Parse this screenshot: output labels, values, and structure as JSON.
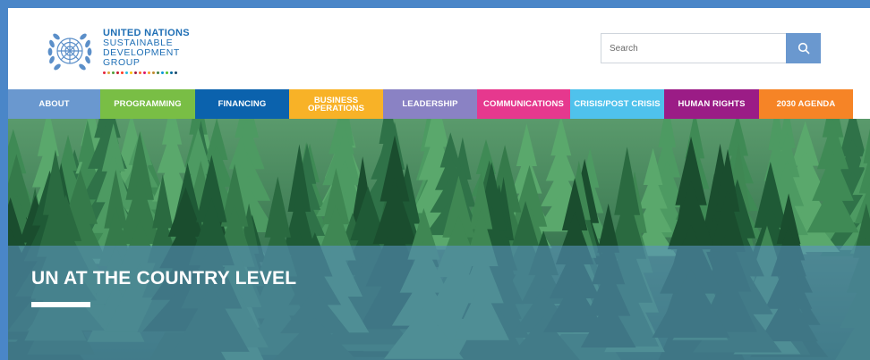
{
  "header": {
    "brand": {
      "line1": "UNITED NATIONS",
      "line2": "SUSTAINABLE",
      "line3": "DEVELOPMENT",
      "line4": "GROUP"
    },
    "logo_icon": "un-emblem-icon",
    "sdg_colors": [
      "#e5243b",
      "#dda63a",
      "#4c9f38",
      "#c5192d",
      "#ff3a21",
      "#26bde2",
      "#fcc30b",
      "#a21942",
      "#fd6925",
      "#dd1367",
      "#fd9d24",
      "#bf8b2e",
      "#3f7e44",
      "#0a97d9",
      "#56c02b",
      "#00689d",
      "#19486a"
    ],
    "search": {
      "placeholder": "Search",
      "value": "",
      "icon": "search-icon"
    }
  },
  "nav": {
    "items": [
      {
        "label": "ABOUT",
        "color": "#6a98cf"
      },
      {
        "label": "PROGRAMMING",
        "color": "#79be45"
      },
      {
        "label": "FINANCING",
        "color": "#0b62ad"
      },
      {
        "label": "BUSINESS OPERATIONS",
        "color": "#f8b227"
      },
      {
        "label": "LEADERSHIP",
        "color": "#8a82c4"
      },
      {
        "label": "COMMUNICATIONS",
        "color": "#e6388e"
      },
      {
        "label": "CRISIS/POST CRISIS",
        "color": "#4fc2ec"
      },
      {
        "label": "HUMAN RIGHTS",
        "color": "#9b1c86"
      },
      {
        "label": "2030 AGENDA",
        "color": "#f68426"
      }
    ]
  },
  "hero": {
    "title": "UN AT THE COUNTRY LEVEL"
  }
}
